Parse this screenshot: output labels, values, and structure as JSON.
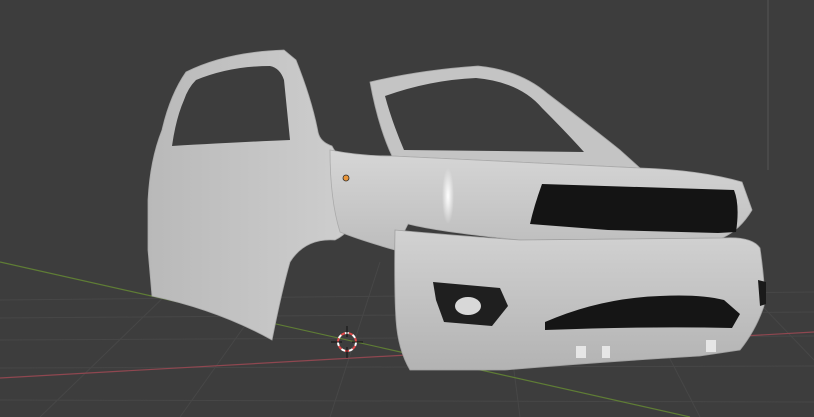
{
  "viewport": {
    "background_color": "#3d3d3d",
    "grid_color": "#4a4a4a",
    "x_axis_color": "#9a4b52",
    "y_axis_color": "#6a8a3a",
    "origin_color": "#e8953a",
    "cursor_color": "#e14b4b"
  },
  "model": {
    "subject": "car-body-mesh",
    "body_color": "#c9c9c9",
    "shadow_color": "#9e9e9e",
    "dark_trim_color": "#141414"
  }
}
